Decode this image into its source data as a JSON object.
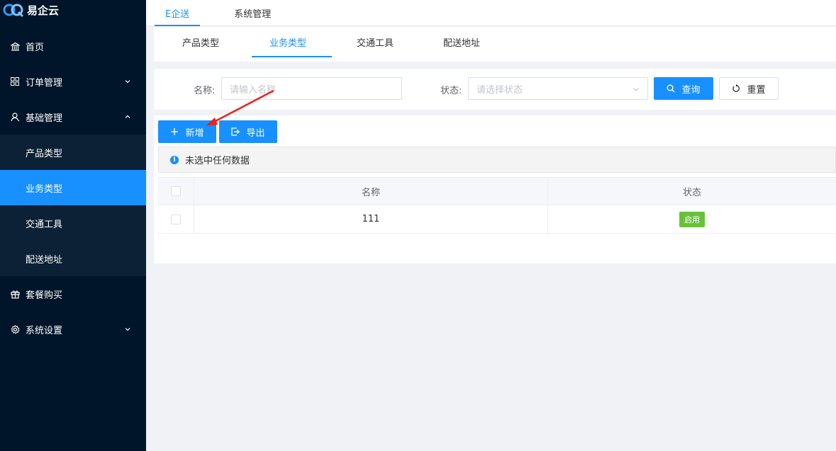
{
  "app": {
    "logo_text": "易企云"
  },
  "sidebar": {
    "items": [
      {
        "label": "首页",
        "icon": "home-icon"
      },
      {
        "label": "订单管理",
        "icon": "grid-icon",
        "expanded": false
      },
      {
        "label": "基础管理",
        "icon": "user-icon",
        "expanded": true,
        "children": [
          {
            "label": "产品类型"
          },
          {
            "label": "业务类型",
            "active": true
          },
          {
            "label": "交通工具"
          },
          {
            "label": "配送地址"
          }
        ]
      },
      {
        "label": "套餐购买",
        "icon": "gift-icon"
      },
      {
        "label": "系统设置",
        "icon": "gear-icon",
        "expanded": false
      }
    ]
  },
  "topnav": {
    "tabs": [
      {
        "label": "E企送",
        "active": true
      },
      {
        "label": "系统管理"
      }
    ]
  },
  "subtabs": {
    "tabs": [
      {
        "label": "产品类型"
      },
      {
        "label": "业务类型",
        "active": true
      },
      {
        "label": "交通工具"
      },
      {
        "label": "配送地址"
      }
    ]
  },
  "search": {
    "name_label": "名称:",
    "name_placeholder": "请输入名称",
    "status_label": "状态:",
    "status_placeholder": "请选择状态",
    "query_label": "查询",
    "reset_label": "重置"
  },
  "toolbar": {
    "add_label": "新增",
    "export_label": "导出"
  },
  "tip": {
    "text": "未选中任何数据"
  },
  "table": {
    "columns": [
      "名称",
      "状态"
    ],
    "rows": [
      {
        "name": "111",
        "status": "启用"
      }
    ]
  },
  "colors": {
    "primary": "#1890ff",
    "sidebar_bg": "#001529",
    "success": "#67c23a"
  }
}
